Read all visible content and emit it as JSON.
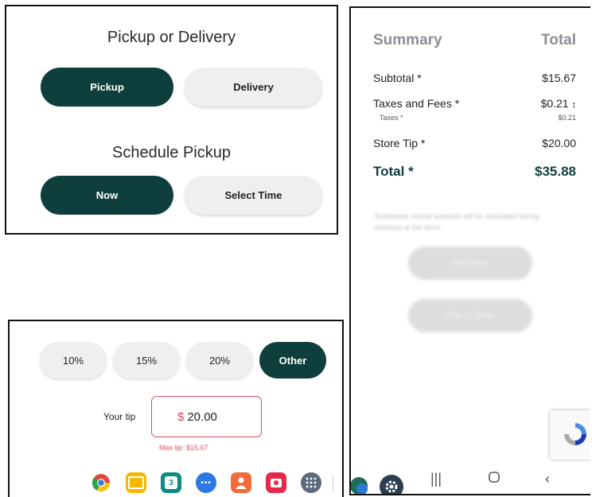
{
  "order_type": {
    "title": "Pickup or Delivery",
    "options": [
      "Pickup",
      "Delivery"
    ],
    "selected": "Pickup"
  },
  "schedule": {
    "title": "Schedule Pickup",
    "options": [
      "Now",
      "Select Time"
    ],
    "selected": "Now"
  },
  "summary": {
    "header_left": "Summary",
    "header_right": "Total",
    "subtotal_label": "Subtotal *",
    "subtotal_value": "$15.67",
    "taxes_label": "Taxes and Fees *",
    "taxes_value": "$0.21",
    "taxes_toggle": "↕",
    "taxes_sub_label": "Taxes *",
    "taxes_sub_value": "$0.21",
    "tip_label": "Store Tip *",
    "tip_value": "$20.00",
    "total_label": "Total *",
    "total_value": "$35.88",
    "disclaimer": "*Estimated. Actual amounts will be calculated during checkout at the store.",
    "btn1": "Pay Now",
    "btn2": "Pay in Store"
  },
  "tip": {
    "options": [
      "10%",
      "15%",
      "20%",
      "Other"
    ],
    "selected": "Other",
    "your_tip_label": "Your tip",
    "currency": "$",
    "value": "20.00",
    "max_tip": "Max tip: $15.67"
  },
  "colors": {
    "brand_dark": "#0f3f3d",
    "error": "#d64a5e"
  },
  "dock_icons": [
    "chrome-icon",
    "folder-icon",
    "calendar-icon",
    "messages-icon",
    "contacts-icon",
    "camera-icon",
    "apps-grid-icon",
    "settings-icon"
  ],
  "calendar_day": "3",
  "nav_bar": [
    "recent-apps-icon",
    "home-icon",
    "back-icon"
  ]
}
